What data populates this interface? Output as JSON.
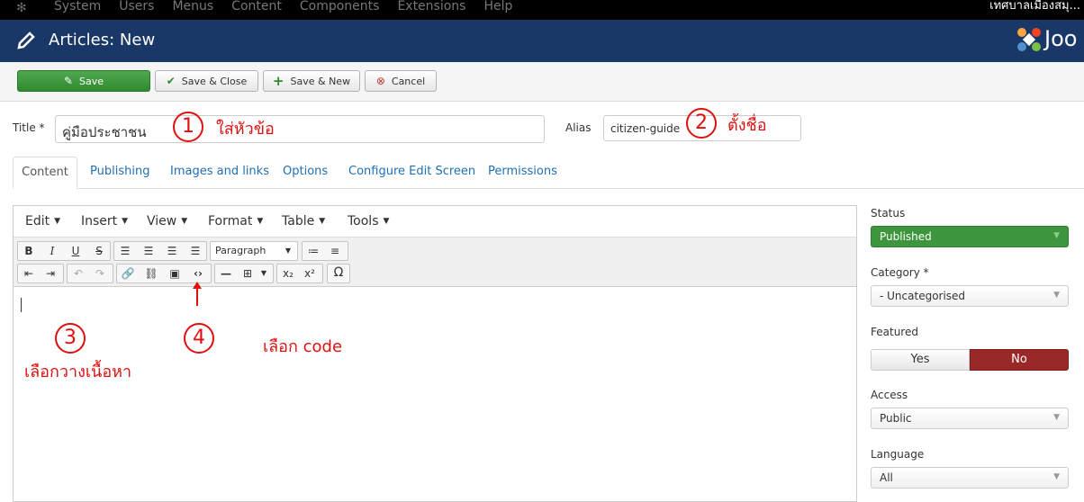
{
  "topbar": {
    "menus": [
      "System",
      "Users",
      "Menus",
      "Content",
      "Components",
      "Extensions",
      "Help"
    ],
    "site_name": "เทศบาลเมืองสมุ..."
  },
  "header": {
    "title": "Articles: New",
    "brand": "Joo"
  },
  "toolbar": {
    "save": "Save",
    "save_close": "Save & Close",
    "save_new": "Save & New",
    "cancel": "Cancel"
  },
  "form": {
    "title_label": "Title *",
    "title_value": "คู่มือประชาชน",
    "alias_label": "Alias",
    "alias_value": "citizen-guide"
  },
  "tabs": [
    "Content",
    "Publishing",
    "Images and links",
    "Options",
    "Configure Edit Screen",
    "Permissions"
  ],
  "editor": {
    "menus": [
      "Edit",
      "Insert",
      "View",
      "Format",
      "Table",
      "Tools"
    ],
    "format_select": "Paragraph"
  },
  "annotations": {
    "n1": "1",
    "t1": "ใส่หัวข้อ",
    "n2": "2",
    "t2": "ตั้งชื่อ",
    "n3": "3",
    "t3": "เลือกวางเนื้อหา",
    "n4": "4",
    "t4": "เลือก code"
  },
  "sidebar": {
    "status_label": "Status",
    "status_value": "Published",
    "category_label": "Category *",
    "category_value": "- Uncategorised",
    "featured_label": "Featured",
    "featured_yes": "Yes",
    "featured_no": "No",
    "access_label": "Access",
    "access_value": "Public",
    "language_label": "Language",
    "language_value": "All"
  },
  "colors": {
    "header_bg": "#1a3867",
    "save_green": "#3d963d",
    "featured_no_red": "#9b2828",
    "annotation_red": "#e01010"
  }
}
